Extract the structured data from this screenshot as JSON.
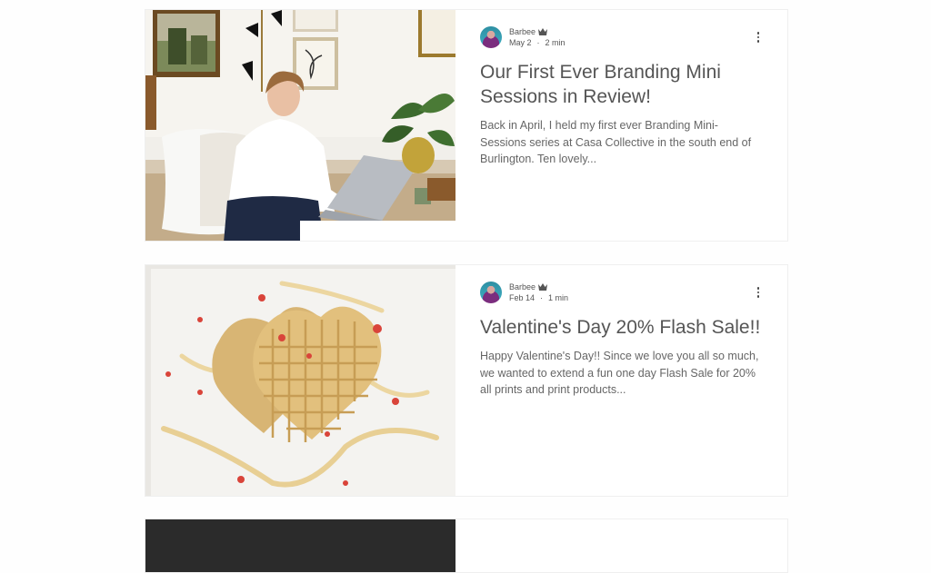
{
  "posts": [
    {
      "author": "Barbee",
      "date": "May 2",
      "read_time": "2 min",
      "title": "Our First Ever Branding Mini Sessions in Review!",
      "excerpt": "Back in April, I held my first ever Branding Mini-Sessions series at Casa Collective in the south end of Burlington. Ten lovely..."
    },
    {
      "author": "Barbee",
      "date": "Feb 14",
      "read_time": "1 min",
      "title": "Valentine's Day 20% Flash Sale!!",
      "excerpt": "Happy Valentine's Day!! Since we love you all so much, we wanted to extend a fun one day Flash Sale for 20% all prints and print products..."
    }
  ],
  "meta_separator": "·",
  "icons": {
    "author_badge": "crown-icon",
    "more_actions": "more-vertical-icon"
  },
  "colors": {
    "title": "#555555",
    "excerpt": "#666666",
    "card_border": "#efefef"
  }
}
